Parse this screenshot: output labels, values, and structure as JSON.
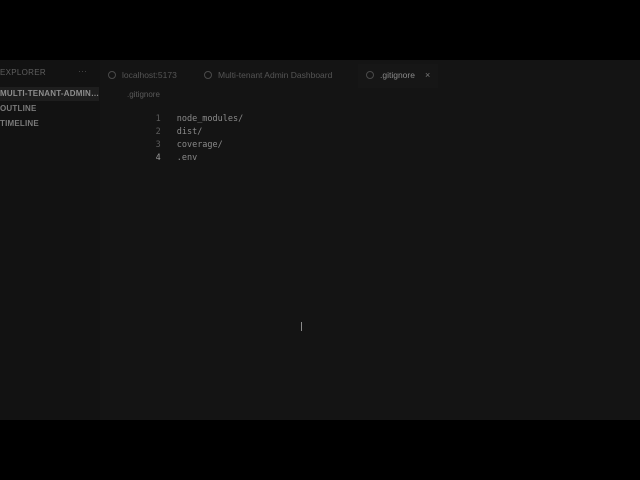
{
  "sidebar": {
    "title": "EXPLORER",
    "more_label": "···",
    "sections": [
      {
        "label": "MULTI-TENANT-ADMIN-D..."
      },
      {
        "label": "OUTLINE"
      },
      {
        "label": "TIMELINE"
      }
    ]
  },
  "tabs": [
    {
      "label": "localhost:5173",
      "icon": "globe-icon"
    },
    {
      "label": "Multi-tenant Admin Dashboard",
      "icon": "globe-icon"
    },
    {
      "label": ".gitignore",
      "icon": "gear-icon",
      "close": "×"
    }
  ],
  "editor": {
    "breadcrumb": ".gitignore",
    "lines": [
      {
        "number": "1",
        "text": "node_modules/"
      },
      {
        "number": "2",
        "text": "dist/"
      },
      {
        "number": "3",
        "text": "coverage/"
      },
      {
        "number": "4",
        "text": ".env"
      }
    ]
  }
}
